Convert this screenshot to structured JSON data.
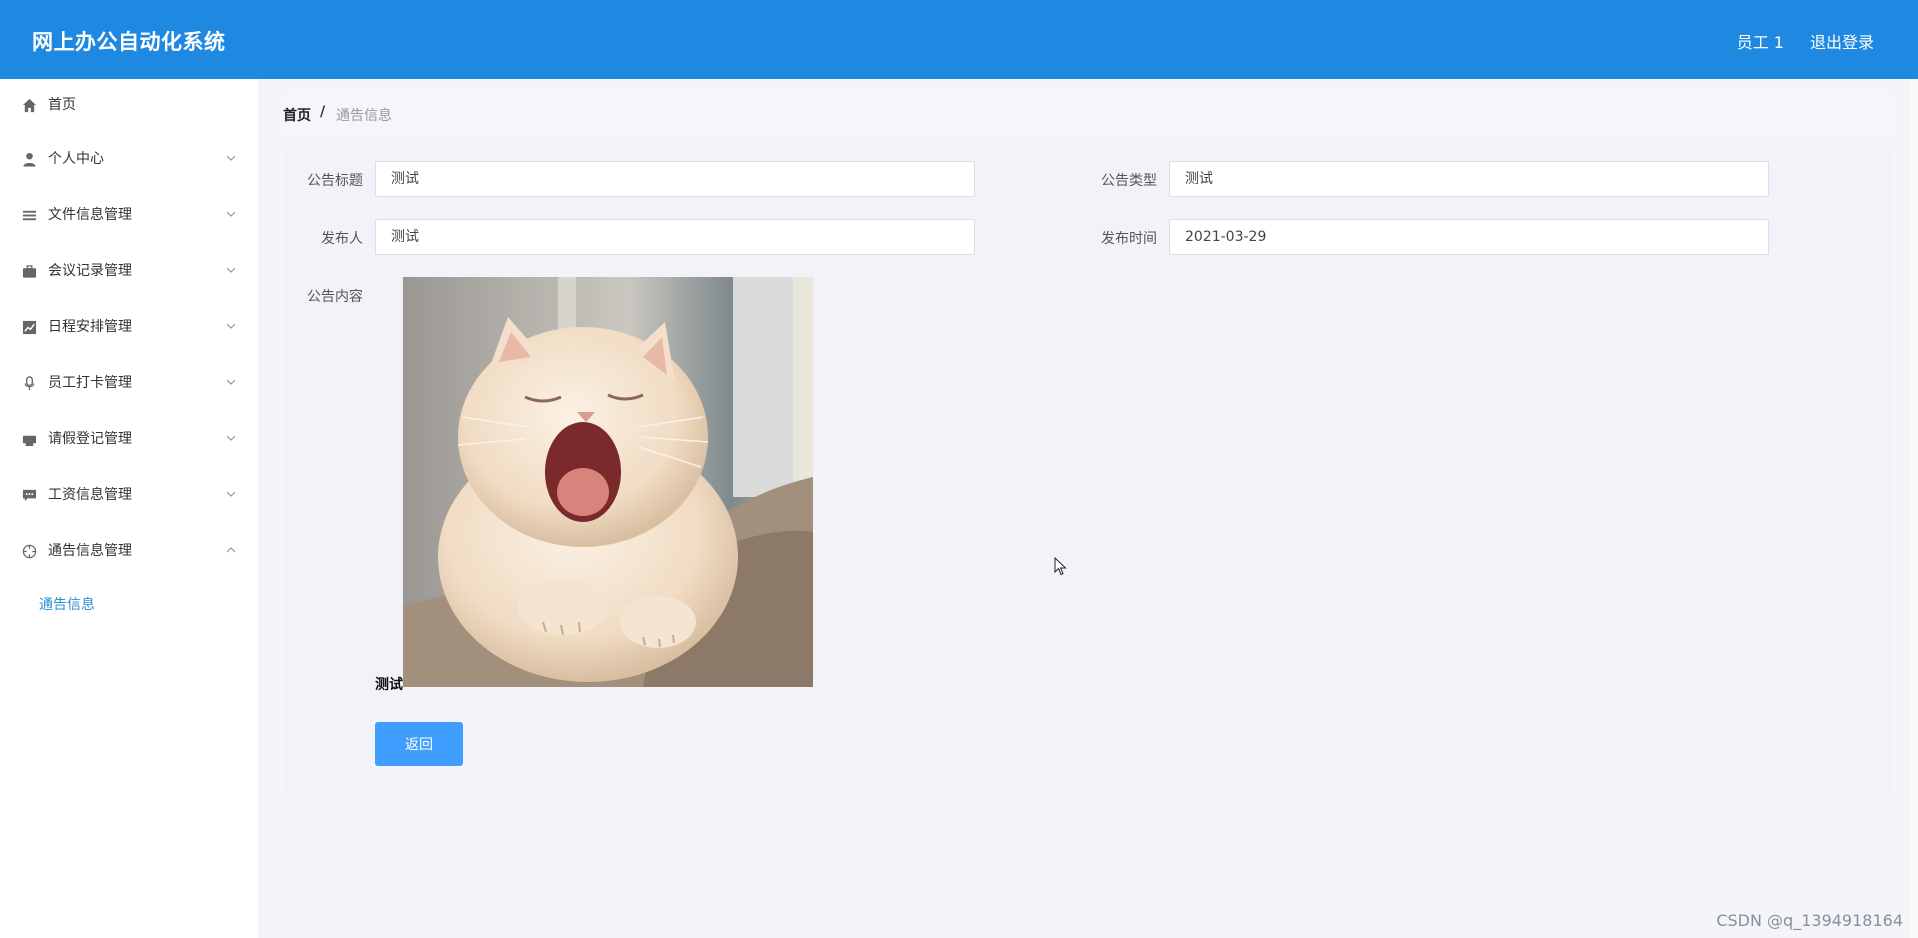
{
  "header": {
    "title": "网上办公自动化系统",
    "user": "员工 1",
    "logout": "退出登录"
  },
  "sidebar": {
    "items": [
      {
        "label": "首页",
        "icon": "home-icon",
        "has_arrow": false
      },
      {
        "label": "个人中心",
        "icon": "user-icon",
        "has_arrow": true
      },
      {
        "label": "文件信息管理",
        "icon": "list-icon",
        "has_arrow": true
      },
      {
        "label": "会议记录管理",
        "icon": "briefcase-icon",
        "has_arrow": true
      },
      {
        "label": "日程安排管理",
        "icon": "chart-icon",
        "has_arrow": true
      },
      {
        "label": "员工打卡管理",
        "icon": "microphone-icon",
        "has_arrow": true
      },
      {
        "label": "请假登记管理",
        "icon": "printer-icon",
        "has_arrow": true
      },
      {
        "label": "工资信息管理",
        "icon": "chat-icon",
        "has_arrow": true
      },
      {
        "label": "通告信息管理",
        "icon": "crosshair-icon",
        "has_arrow": true,
        "expanded": true
      }
    ],
    "submenu": {
      "label": "通告信息",
      "active": true
    }
  },
  "breadcrumb": {
    "home": "首页",
    "separator": "/",
    "current": "通告信息"
  },
  "form": {
    "title_label": "公告标题",
    "title_value": "测试",
    "type_label": "公告类型",
    "type_value": "测试",
    "publisher_label": "发布人",
    "publisher_value": "测试",
    "publish_time_label": "发布时间",
    "publish_time_value": "2021-03-29",
    "content_label": "公告内容",
    "content_caption": "测试",
    "back_button": "返回"
  },
  "watermark": "CSDN @q_1394918164",
  "colors": {
    "header_bg": "#1f89e2",
    "accent": "#409eff",
    "active_link": "#2d8fd6"
  }
}
